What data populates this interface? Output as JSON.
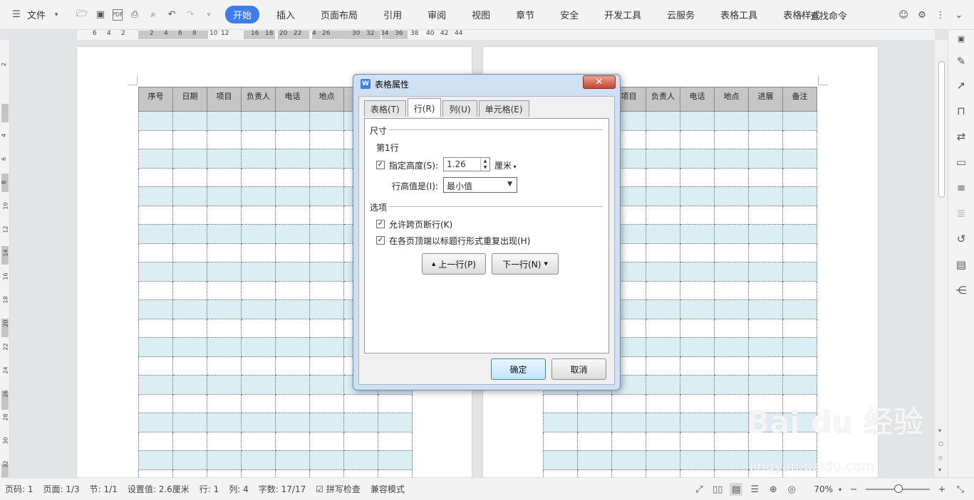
{
  "menubar": {
    "file_label": "文件",
    "tabs": [
      "开始",
      "插入",
      "页面布局",
      "引用",
      "审阅",
      "视图",
      "章节",
      "安全",
      "开发工具",
      "云服务",
      "表格工具",
      "表格样式"
    ],
    "search_label": "查找命令"
  },
  "ruler_numbers": [
    "6",
    "4",
    "2",
    "2",
    "4",
    "6",
    "8",
    "10",
    "12",
    "16",
    "18",
    "20",
    "22",
    "4",
    "26",
    "30",
    "32",
    "34",
    "36",
    "38",
    "40",
    "42",
    "44"
  ],
  "vruler_numbers": [
    "2",
    "4",
    "6",
    "8",
    "10",
    "12",
    "14",
    "16",
    "18",
    "20",
    "22",
    "24",
    "26",
    "28",
    "30",
    "32"
  ],
  "table": {
    "headers_left": [
      "序号",
      "日期",
      "项目",
      "负责人",
      "电话",
      "地点",
      "",
      ""
    ],
    "headers_right": [
      "",
      "",
      "项目",
      "负责人",
      "电话",
      "地点",
      "进展",
      "备注"
    ]
  },
  "dialog": {
    "title": "表格属性",
    "close": "✕",
    "tabs": [
      "表格(T)",
      "行(R)",
      "列(U)",
      "单元格(E)"
    ],
    "size_section": "尺寸",
    "row_label": "第1行",
    "specify_height_label": "指定高度(S):",
    "height_value": "1.26",
    "unit": "厘米",
    "row_height_is_label": "行高值是(I):",
    "row_height_mode": "最小值",
    "options_section": "选项",
    "allow_break": "允许跨页断行(K)",
    "repeat_header": "在各页顶端以标题行形式重复出现(H)",
    "prev_row": "上一行(P)",
    "next_row": "下一行(N)",
    "ok": "确定",
    "cancel": "取消"
  },
  "statusbar": {
    "page_code": "页码: 1",
    "pages": "页面: 1/3",
    "section": "节: 1/1",
    "setting": "设置值: 2.6厘米",
    "row": "行: 1",
    "col": "列: 4",
    "words": "字数: 17/17",
    "spellcheck": "拼写检查",
    "compat": "兼容模式",
    "zoom": "70%"
  },
  "watermark": {
    "brand": "Bai du 经验",
    "url": "jingyan.baidu.com"
  },
  "colors": {
    "accent": "#3d7df0",
    "row_blue": "#daeef3",
    "header_gray": "#c6c6c6"
  }
}
